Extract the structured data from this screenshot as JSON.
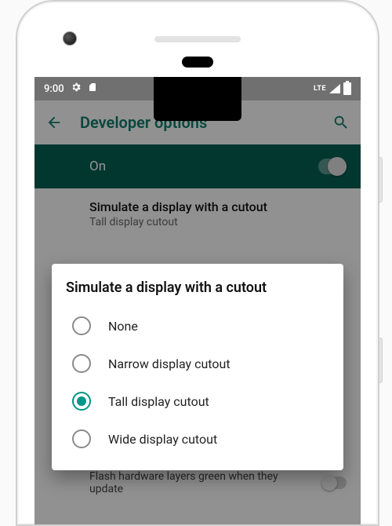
{
  "status": {
    "time": "9:00",
    "network_label": "LTE"
  },
  "appbar": {
    "title": "Developer options"
  },
  "master_toggle": {
    "label": "On",
    "enabled": true
  },
  "cutout_row": {
    "title": "Simulate a display with a cutout",
    "subtitle": "Tall display cutout"
  },
  "bottom_row": {
    "title": "Flash hardware layers green when they update"
  },
  "dialog": {
    "title": "Simulate a display with a cutout",
    "selected_index": 2,
    "options": [
      "None",
      "Narrow display cutout",
      "Tall display cutout",
      "Wide display cutout"
    ]
  },
  "colors": {
    "accent": "#009688",
    "appbar_text": "#0f7a6a",
    "toggle_bar_bg": "#045f54"
  }
}
